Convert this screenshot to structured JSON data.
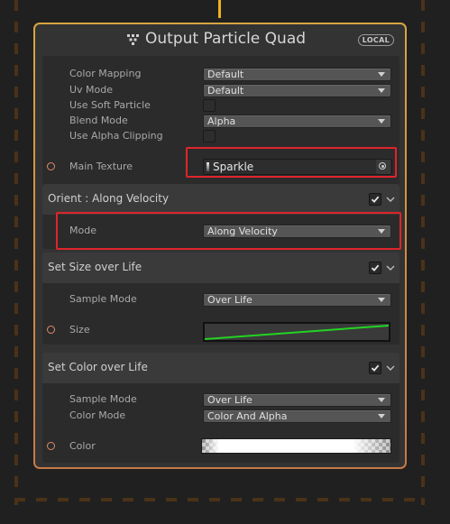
{
  "node": {
    "title": "Output Particle Quad",
    "badge": "LOCAL"
  },
  "output_block": {
    "rows": [
      {
        "label": "Color Mapping",
        "value": "Default"
      },
      {
        "label": "Uv Mode",
        "value": "Default"
      },
      {
        "label": "Use Soft Particle"
      },
      {
        "label": "Blend Mode",
        "value": "Alpha"
      },
      {
        "label": "Use Alpha Clipping"
      }
    ],
    "main_texture": {
      "label": "Main Texture",
      "value": "Sparkle"
    }
  },
  "orient_block": {
    "title": "Orient : Along Velocity",
    "enabled": true,
    "mode_label": "Mode",
    "mode_value": "Along Velocity"
  },
  "size_block": {
    "title": "Set Size over Life",
    "enabled": true,
    "sample_label": "Sample Mode",
    "sample_value": "Over Life",
    "size_label": "Size"
  },
  "color_block": {
    "title": "Set Color over Life",
    "enabled": true,
    "sample_label": "Sample Mode",
    "sample_value": "Over Life",
    "color_mode_label": "Color Mode",
    "color_mode_value": "Color And Alpha",
    "color_label": "Color"
  },
  "colors": {
    "node_border_top": "#d8a640",
    "node_border_bottom": "#c87848",
    "curve_line": "#22d422",
    "highlight": "#e0242a",
    "flow": "#f0b020"
  }
}
